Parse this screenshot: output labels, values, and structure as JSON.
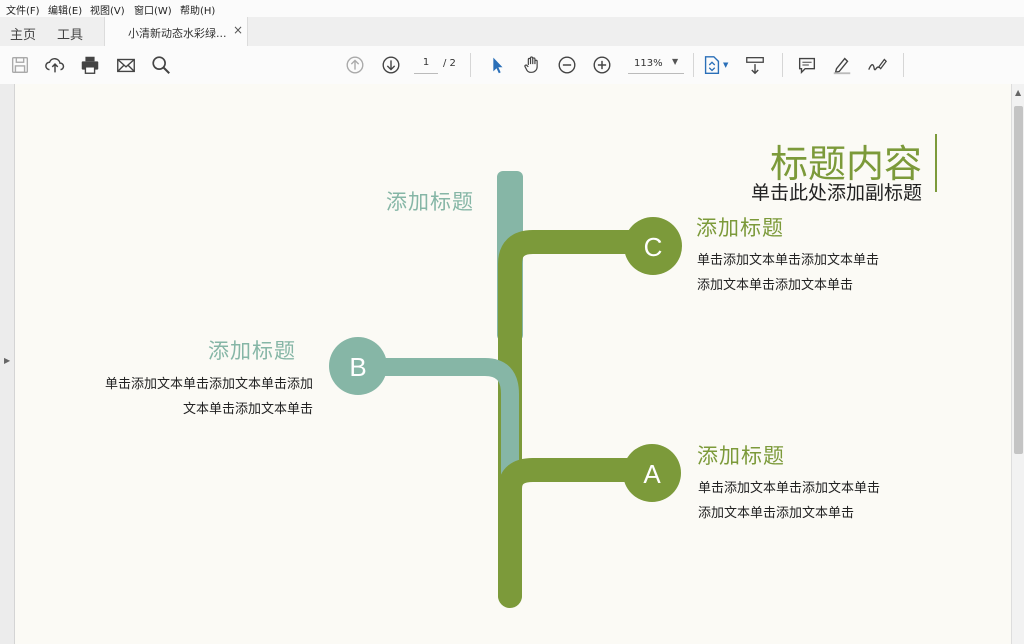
{
  "menu": [
    "文件(F)",
    "编辑(E)",
    "视图(V)",
    "窗口(W)",
    "帮助(H)"
  ],
  "nav": {
    "home": "主页",
    "tools": "工具"
  },
  "tab": {
    "title": "小清新动态水彩绿...",
    "close": "×"
  },
  "toolbar": {
    "page_current": "1",
    "page_total": "/ 2",
    "zoom": "113%"
  },
  "slide": {
    "title": "标题内容",
    "subtitle": "单击此处添加副标题",
    "nodes": [
      {
        "id": "c",
        "letter": "C",
        "heading": "添加标题",
        "body_line1": "单击添加文本单击添加文本单击",
        "body_line2": "添加文本单击添加文本单击"
      },
      {
        "id": "b",
        "letter": "B",
        "heading": "添加标题",
        "body_line1": "单击添加文本单击添加文本单击添加",
        "body_line2": "文本单击添加文本单击"
      },
      {
        "id": "a",
        "letter": "A",
        "heading": "添加标题",
        "body_line1": "单击添加文本单击添加文本单击",
        "body_line2": "添加文本单击添加文本单击"
      }
    ],
    "top_heading": "添加标题"
  },
  "colors": {
    "green": "#7c9a3a",
    "teal": "#86b6a6",
    "page_bg": "#fbfaf5"
  },
  "icons": [
    "save-icon",
    "upload-icon",
    "print-icon",
    "mail-icon",
    "search-icon",
    "prev-page-icon",
    "next-page-icon",
    "select-cursor-icon",
    "hand-icon",
    "zoom-out-icon",
    "zoom-in-icon",
    "fit-page-icon",
    "scroll-mode-icon",
    "comment-icon",
    "highlight-icon",
    "sign-icon"
  ]
}
